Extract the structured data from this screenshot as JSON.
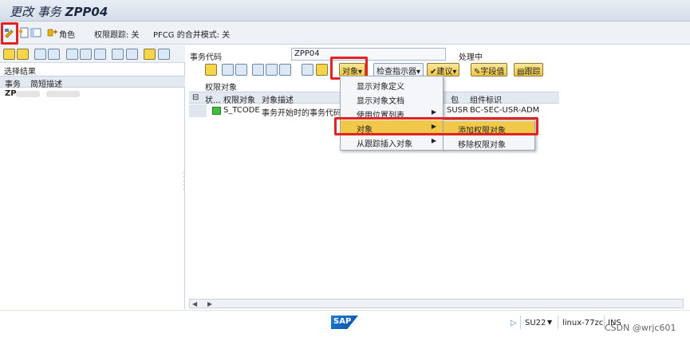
{
  "title": {
    "prefix": "更改 事务",
    "code": "ZPP04"
  },
  "app_toolbar": {
    "role_label": "角色",
    "trace_label": "权限跟踪: 关",
    "merge_label": "PFCG 的合并模式: 关"
  },
  "left_pane": {
    "title": "选择结果",
    "col_tcode": "事务",
    "col_desc": "简短描述",
    "row_code": "ZP"
  },
  "right_pane": {
    "tcode_label": "事务代码",
    "tcode_value": "ZPP04",
    "status_label": "处理中",
    "toolbar": {
      "object_btn": "对象",
      "check_btn": "检查指示器",
      "propose_btn": "建议",
      "field_btn": "字段值",
      "trace_btn": "跟踪"
    },
    "grid_title": "权限对象",
    "columns": {
      "status": "状...",
      "auth_object": "权限对象",
      "object_desc": "对象描述",
      "package": "包",
      "component": "组件标识"
    },
    "row": {
      "auth_object": "S_TCODE",
      "object_desc": "事务开始时的事务代码",
      "package": "SUSR",
      "component": "BC-SEC-USR-ADM"
    }
  },
  "context_menu": {
    "items": [
      {
        "label": "显示对象定义",
        "arrow": ""
      },
      {
        "label": "显示对象文档",
        "arrow": ""
      },
      {
        "label": "使用位置列表",
        "arrow": "▶"
      },
      {
        "label": "对象",
        "arrow": "▶"
      },
      {
        "label": "从跟踪插入对象",
        "arrow": "▶"
      }
    ],
    "submenu": [
      {
        "label": "添加权限对象"
      },
      {
        "label": "移除权限对象"
      }
    ]
  },
  "status_bar": {
    "logo": "SAP",
    "tcode": "SU22",
    "server": "linux-77zc",
    "mode": "INS",
    "watermark": "CSDN @wrjc601"
  },
  "colors": {
    "highlight": "#f2c84b",
    "red_frame": "#e52222",
    "status_green": "#3fbf3f"
  }
}
